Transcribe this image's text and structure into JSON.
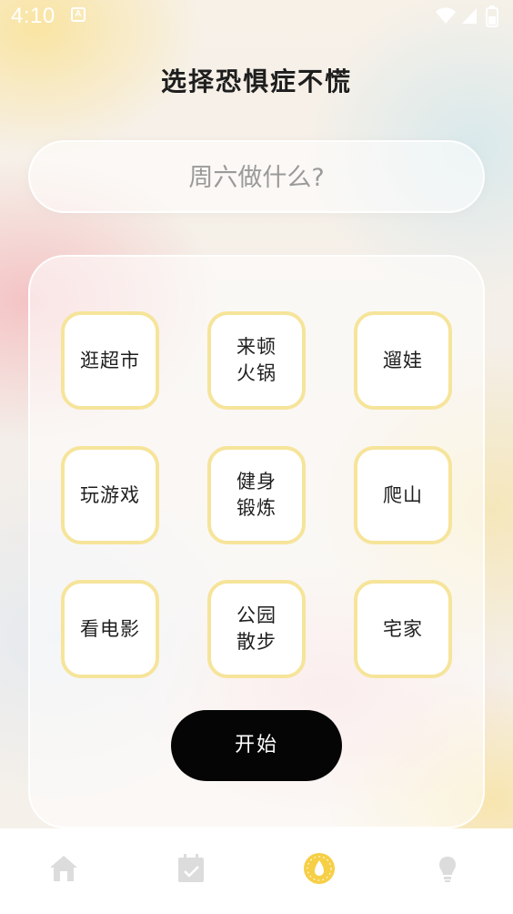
{
  "status_bar": {
    "time": "4:10",
    "notification_badge": "A",
    "icons": [
      "wifi-icon",
      "cellular-signal-icon",
      "battery-icon"
    ]
  },
  "page": {
    "title": "选择恐惧症不慌"
  },
  "question": {
    "text": "周六做什么?"
  },
  "options": [
    {
      "label": "逛超市"
    },
    {
      "label": "来顿火锅"
    },
    {
      "label": "遛娃"
    },
    {
      "label": "玩游戏"
    },
    {
      "label": "健身锻炼"
    },
    {
      "label": "爬山"
    },
    {
      "label": "看电影"
    },
    {
      "label": "公园散步"
    },
    {
      "label": "宅家"
    }
  ],
  "start_button": {
    "label": "开始"
  },
  "bottom_nav": {
    "items": [
      {
        "icon": "home-icon",
        "active": false
      },
      {
        "icon": "calendar-check-icon",
        "active": false
      },
      {
        "icon": "decision-wheel-icon",
        "active": true
      },
      {
        "icon": "lightbulb-icon",
        "active": false
      }
    ]
  },
  "colors": {
    "option_border": "#f6e49a",
    "start_button_bg": "#050505",
    "active_nav": "#f6cf46",
    "inactive_nav": "#dcdcdc",
    "title": "#1e1e1e",
    "placeholder_text": "#9a9a9a"
  }
}
